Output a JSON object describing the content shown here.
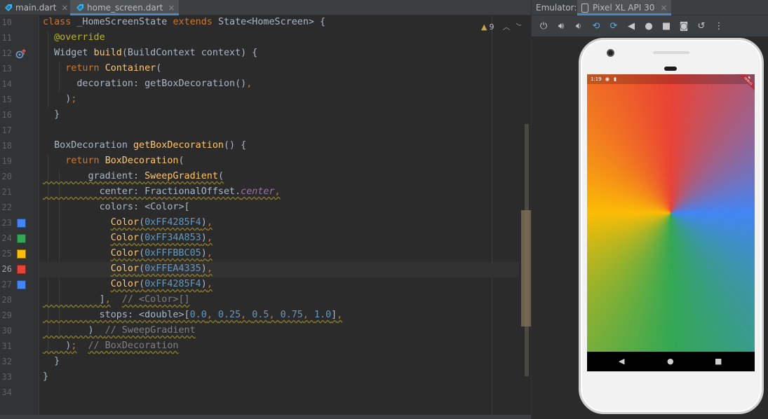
{
  "editor_tabs": [
    {
      "label": "main.dart",
      "close": "×",
      "active": false
    },
    {
      "label": "home_screen.dart",
      "close": "×",
      "active": true
    }
  ],
  "inspection": {
    "count": "9"
  },
  "code_lines": [
    {
      "n": "10",
      "tokens": [
        [
          "kw",
          "class "
        ],
        [
          "plain",
          "_HomeScreenState "
        ],
        [
          "kw",
          "extends "
        ],
        [
          "plain",
          "State<HomeScreen> {"
        ]
      ]
    },
    {
      "n": "11",
      "tokens": [
        [
          "plain",
          "  "
        ],
        [
          "ann",
          "@override"
        ]
      ]
    },
    {
      "n": "12",
      "tokens": [
        [
          "plain",
          "  Widget "
        ],
        [
          "fn",
          "build"
        ],
        [
          "plain",
          "(BuildContext context) {"
        ]
      ]
    },
    {
      "n": "13",
      "tokens": [
        [
          "plain",
          "    "
        ],
        [
          "kw",
          "return "
        ],
        [
          "fn",
          "Container"
        ],
        [
          "plain",
          "("
        ]
      ]
    },
    {
      "n": "14",
      "tokens": [
        [
          "plain",
          "      decoration: getBoxDecoration()"
        ],
        [
          "kw",
          ","
        ]
      ]
    },
    {
      "n": "15",
      "tokens": [
        [
          "plain",
          "    )"
        ],
        [
          "kw",
          ";"
        ]
      ]
    },
    {
      "n": "16",
      "tokens": [
        [
          "plain",
          "  }"
        ]
      ]
    },
    {
      "n": "17",
      "tokens": []
    },
    {
      "n": "18",
      "tokens": [
        [
          "plain",
          "  BoxDecoration "
        ],
        [
          "fn",
          "getBoxDecoration"
        ],
        [
          "plain",
          "() {"
        ]
      ]
    },
    {
      "n": "19",
      "tokens": [
        [
          "plain",
          "    "
        ],
        [
          "kw",
          "return "
        ],
        [
          "fn",
          "BoxDecoration"
        ],
        [
          "plain",
          "("
        ]
      ]
    },
    {
      "n": "20",
      "tokens": [
        [
          "plain",
          "        gradient: "
        ],
        [
          "fn",
          "SweepGradient"
        ],
        [
          "plain",
          "("
        ]
      ]
    },
    {
      "n": "21",
      "tokens": [
        [
          "plain",
          "          center: FractionalOffset."
        ],
        [
          "it",
          "center"
        ],
        [
          "kw",
          ","
        ]
      ]
    },
    {
      "n": "22",
      "tokens": [
        [
          "plain",
          "          colors: <Color>["
        ]
      ]
    },
    {
      "n": "23",
      "tokens": [
        [
          "plain",
          "            "
        ],
        [
          "fn",
          "Color"
        ],
        [
          "plain",
          "("
        ],
        [
          "hex",
          "0xFF4285F4"
        ],
        [
          "plain",
          ")"
        ],
        [
          "kw",
          ","
        ]
      ]
    },
    {
      "n": "24",
      "tokens": [
        [
          "plain",
          "            "
        ],
        [
          "fn",
          "Color"
        ],
        [
          "plain",
          "("
        ],
        [
          "hex",
          "0xFF34A853"
        ],
        [
          "plain",
          ")"
        ],
        [
          "kw",
          ","
        ]
      ]
    },
    {
      "n": "25",
      "tokens": [
        [
          "plain",
          "            "
        ],
        [
          "fn",
          "Color"
        ],
        [
          "plain",
          "("
        ],
        [
          "hex",
          "0xFFFBBC05"
        ],
        [
          "plain",
          ")"
        ],
        [
          "kw",
          ","
        ]
      ]
    },
    {
      "n": "26",
      "tokens": [
        [
          "plain",
          "            "
        ],
        [
          "fn",
          "Color"
        ],
        [
          "plain",
          "("
        ],
        [
          "hex",
          "0xFFEA4335"
        ],
        [
          "plain",
          ")"
        ],
        [
          "kw",
          ","
        ]
      ]
    },
    {
      "n": "27",
      "tokens": [
        [
          "plain",
          "            "
        ],
        [
          "fn",
          "Color"
        ],
        [
          "plain",
          "("
        ],
        [
          "hex",
          "0xFF4285F4"
        ],
        [
          "plain",
          ")"
        ],
        [
          "kw",
          ","
        ]
      ]
    },
    {
      "n": "28",
      "tokens": [
        [
          "plain",
          "          ]"
        ],
        [
          "kw",
          ","
        ],
        [
          "plain",
          "  "
        ],
        [
          "cm",
          "// <Color>[]"
        ]
      ]
    },
    {
      "n": "29",
      "tokens": [
        [
          "plain",
          "          stops: <double>["
        ],
        [
          "num",
          "0.0"
        ],
        [
          "kw",
          ", "
        ],
        [
          "num",
          "0.25"
        ],
        [
          "kw",
          ", "
        ],
        [
          "num",
          "0.5"
        ],
        [
          "kw",
          ", "
        ],
        [
          "num",
          "0.75"
        ],
        [
          "kw",
          ", "
        ],
        [
          "num",
          "1.0"
        ],
        [
          "plain",
          "]"
        ],
        [
          "kw",
          ","
        ]
      ]
    },
    {
      "n": "30",
      "tokens": [
        [
          "plain",
          "        )  "
        ],
        [
          "cm",
          "// SweepGradient"
        ]
      ]
    },
    {
      "n": "31",
      "tokens": [
        [
          "plain",
          "    )"
        ],
        [
          "kw",
          ";"
        ],
        [
          "plain",
          "  "
        ],
        [
          "cm",
          "// BoxDecoration"
        ]
      ]
    },
    {
      "n": "32",
      "tokens": [
        [
          "plain",
          "  }"
        ]
      ]
    },
    {
      "n": "33",
      "tokens": [
        [
          "plain",
          "}"
        ]
      ]
    },
    {
      "n": "34",
      "tokens": []
    }
  ],
  "current_line": "26",
  "gutter_swatches": {
    "23": "#4285F4",
    "24": "#34A853",
    "25": "#FBBC05",
    "26": "#EA4335",
    "27": "#4285F4"
  },
  "emulator": {
    "label": "Emulator:",
    "device_tab": "Pixel XL API 30",
    "close": "×",
    "toolbar_icons": [
      "power-icon",
      "volume-up-icon",
      "volume-down-icon",
      "rotate-left-icon",
      "rotate-right-icon",
      "back-icon",
      "home-icon",
      "overview-icon",
      "screenshot-icon",
      "snapshot-icon",
      "more-icon"
    ],
    "status_time": "1:19",
    "debug_banner": "DEBUG",
    "gradient_colors": [
      "#4285F4",
      "#34A853",
      "#FBBC05",
      "#EA4335",
      "#4285F4"
    ],
    "gradient_stops": [
      0.0,
      0.25,
      0.5,
      0.75,
      1.0
    ]
  }
}
